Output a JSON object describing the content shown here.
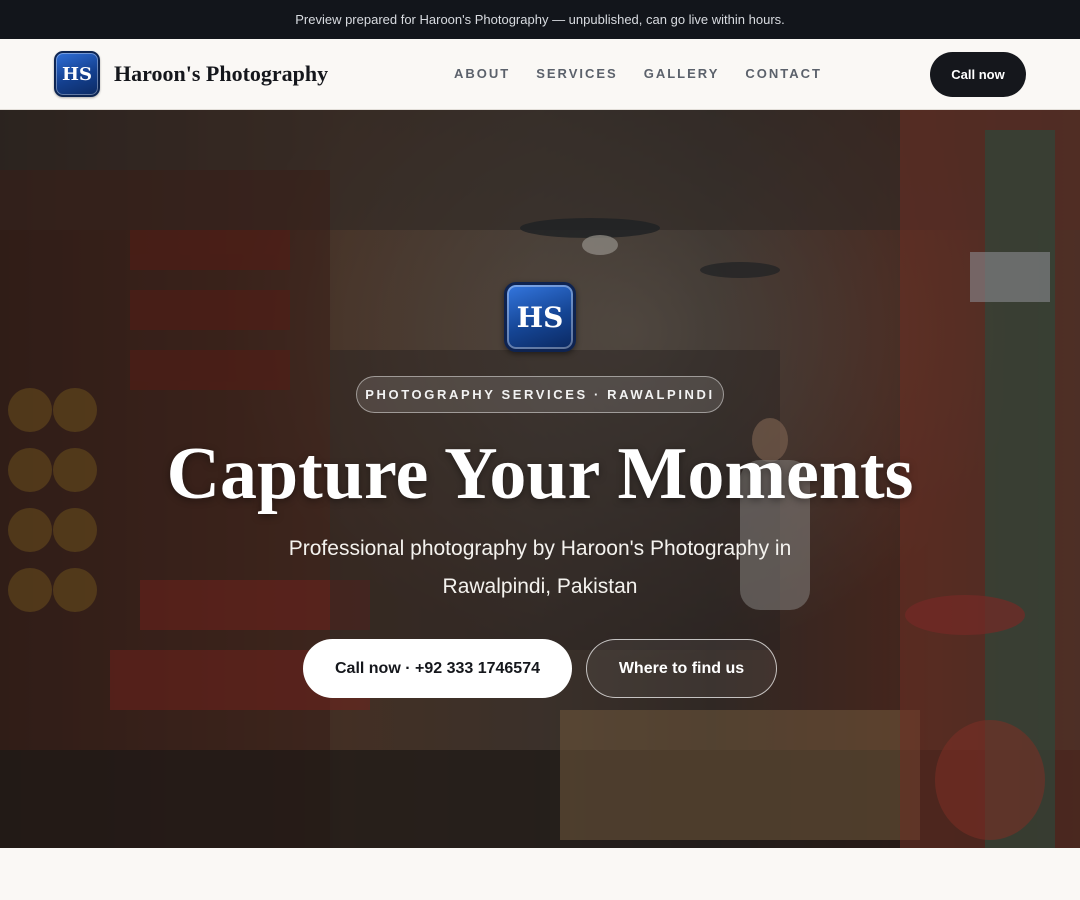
{
  "preview_banner": {
    "text": "Preview prepared for Haroon's Photography — unpublished, can go live within hours."
  },
  "header": {
    "logo_text": "HS",
    "brand_name": "Haroon's Photography",
    "nav": [
      {
        "label": "ABOUT"
      },
      {
        "label": "SERVICES"
      },
      {
        "label": "GALLERY"
      },
      {
        "label": "CONTACT"
      }
    ],
    "cta_label": "Call now"
  },
  "hero": {
    "logo_text": "HS",
    "eyebrow": "PHOTOGRAPHY SERVICES · RAWALPINDI",
    "title": "Capture Your Moments",
    "subtitle": "Professional photography by Haroon's Photography in Rawalpindi, Pakistan",
    "primary_button": "Call now · +92 333 1746574",
    "secondary_button": "Where to find us",
    "background_icon": "shop-interior-photo"
  },
  "colors": {
    "dark": "#15171c",
    "banner_bg": "#12151b",
    "logo_blue": "#154594",
    "page_bg": "#faf8f5"
  }
}
